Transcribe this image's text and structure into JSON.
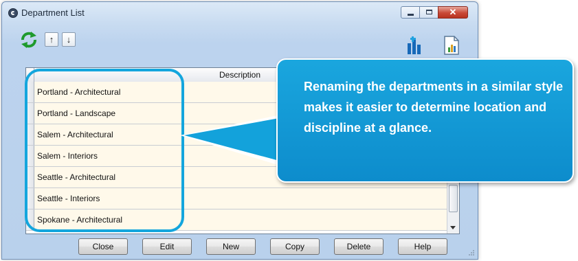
{
  "window": {
    "title": "Department List"
  },
  "toolbar": {
    "refresh_icon": "refresh-icon",
    "move_up_label": "↑",
    "move_down_label": "↓",
    "report_icon": "report-icon",
    "document_icon": "document-icon"
  },
  "grid": {
    "columns": [
      "Description"
    ],
    "rows": [
      "Portland - Architectural",
      "Portland - Landscape",
      "Salem - Architectural",
      "Salem - Interiors",
      "Seattle - Architectural",
      "Seattle - Interiors",
      "Spokane - Architectural"
    ]
  },
  "buttons": {
    "close": "Close",
    "edit": "Edit",
    "new": "New",
    "copy": "Copy",
    "delete": "Delete",
    "help": "Help"
  },
  "callout": {
    "text": "Renaming the departments in a similar style makes it easier to determine location and discipline at a glance."
  },
  "colors": {
    "callout": "#14a6dd",
    "row_background": "#fff9ea",
    "close_button": "#c94937"
  }
}
